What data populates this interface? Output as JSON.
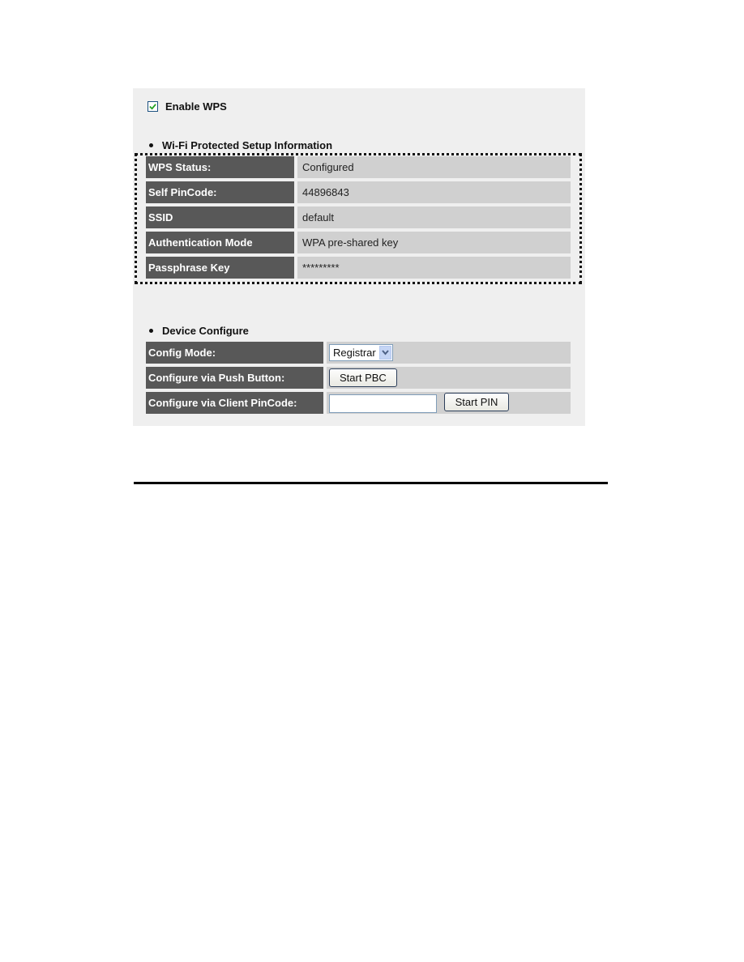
{
  "enable_wps": {
    "label": "Enable WPS",
    "checked": true
  },
  "wps_info": {
    "title": "Wi-Fi Protected Setup Information",
    "rows": [
      {
        "label": "WPS Status:",
        "value": "Configured"
      },
      {
        "label": "Self PinCode:",
        "value": "44896843"
      },
      {
        "label": "SSID",
        "value": "default"
      },
      {
        "label": "Authentication Mode",
        "value": "WPA pre-shared key"
      },
      {
        "label": "Passphrase Key",
        "value": "*********"
      }
    ]
  },
  "device_configure": {
    "title": "Device Configure",
    "config_mode": {
      "label": "Config Mode:",
      "selected": "Registrar"
    },
    "push_button": {
      "label": "Configure via Push Button:",
      "button": "Start PBC"
    },
    "client_pin": {
      "label": "Configure via Client PinCode:",
      "input_value": "",
      "button": "Start PIN"
    }
  }
}
